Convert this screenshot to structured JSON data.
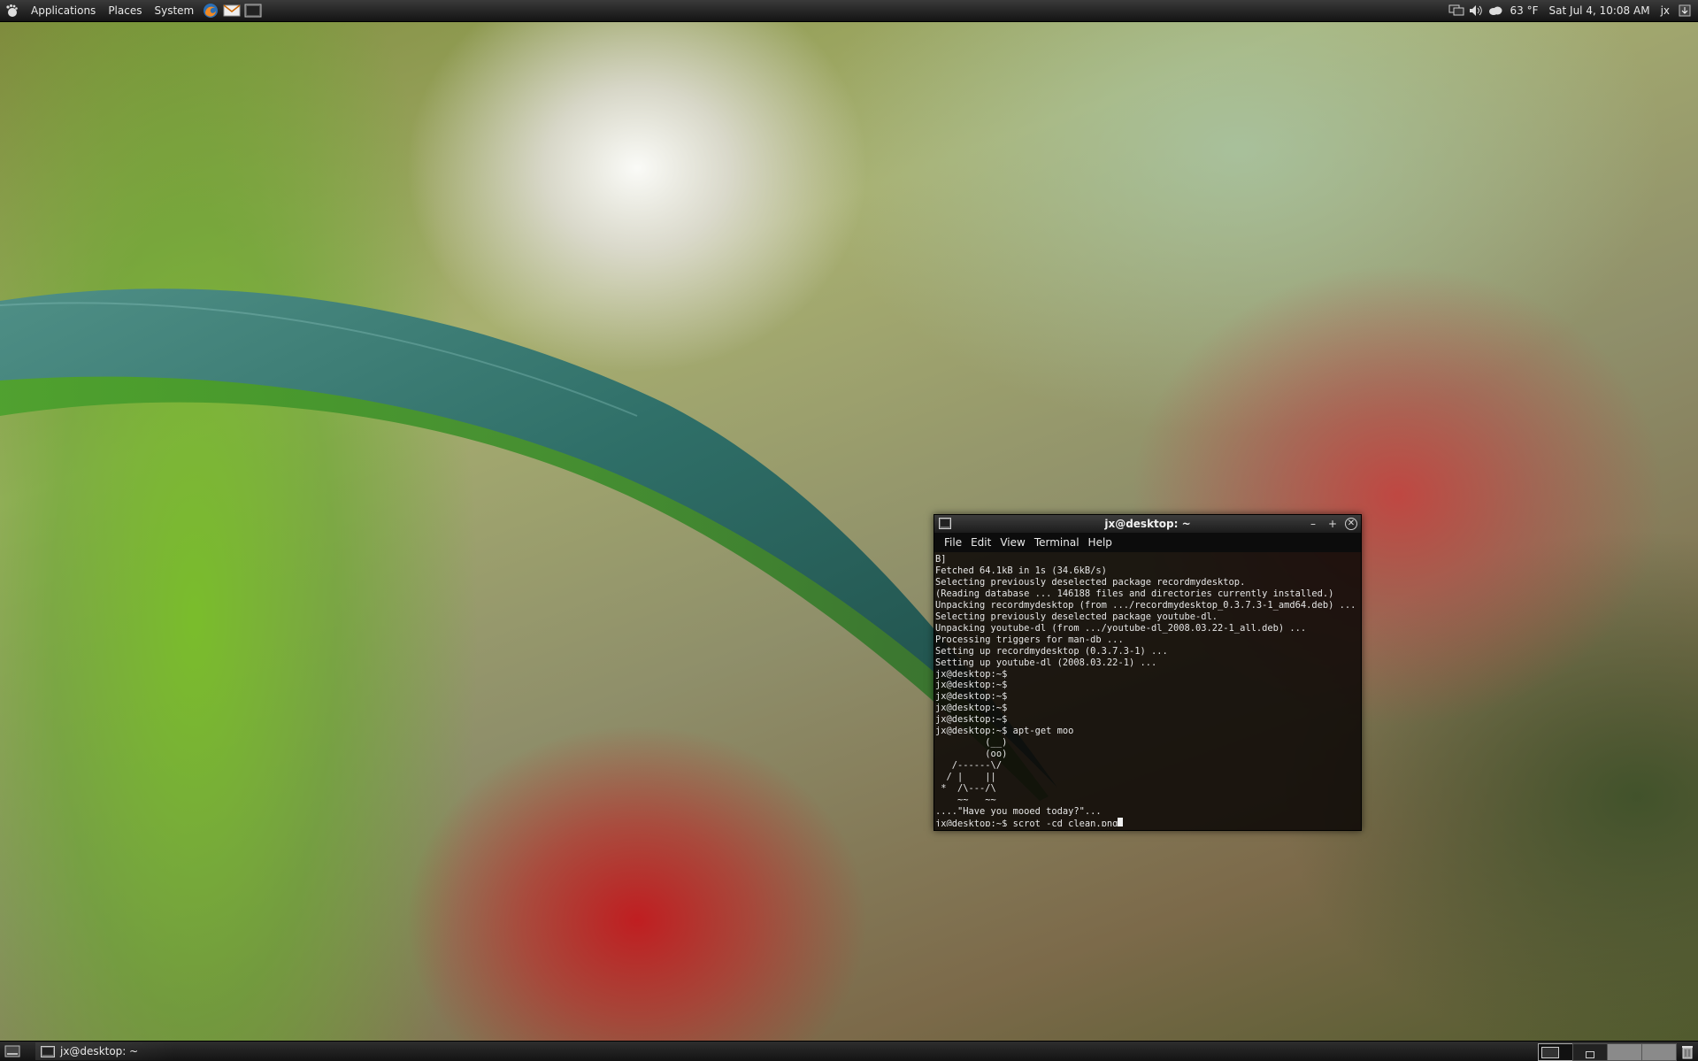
{
  "top_panel": {
    "menus": [
      "Applications",
      "Places",
      "System"
    ],
    "launchers": [
      "firefox-icon",
      "mail-icon",
      "terminal-launcher-icon"
    ],
    "tray": {
      "weather": "63 °F",
      "clock": "Sat Jul  4, 10:08 AM",
      "user": "jx"
    }
  },
  "terminal": {
    "title": "jx@desktop: ~",
    "menu": [
      "File",
      "Edit",
      "View",
      "Terminal",
      "Help"
    ],
    "lines": [
      "B]",
      "Fetched 64.1kB in 1s (34.6kB/s)",
      "Selecting previously deselected package recordmydesktop.",
      "(Reading database ... 146188 files and directories currently installed.)",
      "Unpacking recordmydesktop (from .../recordmydesktop_0.3.7.3-1_amd64.deb) ...",
      "Selecting previously deselected package youtube-dl.",
      "Unpacking youtube-dl (from .../youtube-dl_2008.03.22-1_all.deb) ...",
      "Processing triggers for man-db ...",
      "Setting up recordmydesktop (0.3.7.3-1) ...",
      "Setting up youtube-dl (2008.03.22-1) ...",
      "jx@desktop:~$",
      "jx@desktop:~$",
      "jx@desktop:~$",
      "jx@desktop:~$",
      "jx@desktop:~$",
      "jx@desktop:~$ apt-get moo",
      "         (__)",
      "         (oo)",
      "   /------\\/",
      "  / |    ||",
      " *  /\\---/\\",
      "    ~~   ~~",
      "....\"Have you mooed today?\"...",
      "jx@desktop:~$ scrot -cd clean.png"
    ]
  },
  "bottom_panel": {
    "task_label": "jx@desktop: ~"
  }
}
